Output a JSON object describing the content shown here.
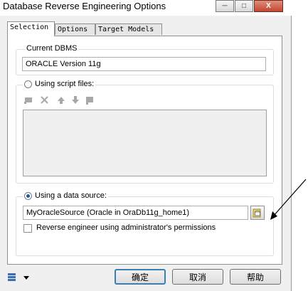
{
  "window": {
    "title": "Database Reverse Engineering Options",
    "minimize_glyph": "─",
    "maximize_glyph": "□",
    "close_glyph": "X"
  },
  "tabs": [
    {
      "label": "Selection",
      "active": true
    },
    {
      "label": "Options",
      "active": false
    },
    {
      "label": "Target Models",
      "active": false
    }
  ],
  "current_dbms": {
    "label": "Current DBMS",
    "value": "ORACLE Version 11g"
  },
  "script_files": {
    "label": "Using script files:",
    "selected": false,
    "toolbar_icons": [
      "add-file-icon",
      "delete-icon",
      "move-up-icon",
      "move-down-icon",
      "move-bottom-icon"
    ]
  },
  "data_source": {
    "label": "Using a data source:",
    "selected": true,
    "value": "MyOracleSource (Oracle in OraDb11g_home1)",
    "browse_icon": "connect-datasource-icon"
  },
  "admin_permissions": {
    "label": "Reverse engineer using administrator's permissions",
    "checked": false
  },
  "footer": {
    "tool_icon": "layers-icon",
    "ok_label": "确定",
    "cancel_label": "取消",
    "help_label": "帮助"
  },
  "colors": {
    "selection_blue": "#1d5aa8",
    "close_button_red": "#c5462f",
    "default_button_border": "#3c7fb1"
  }
}
